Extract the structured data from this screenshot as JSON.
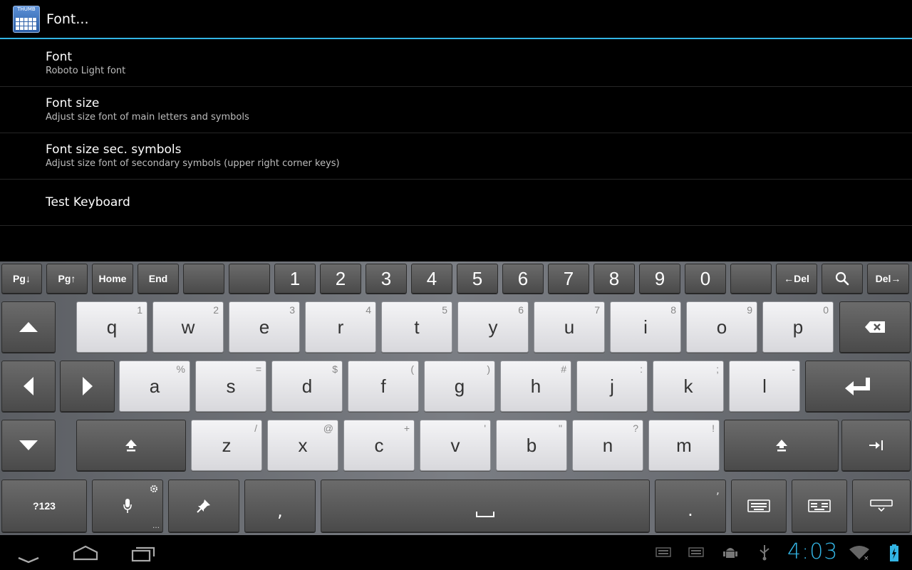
{
  "actionbar": {
    "icon_text": "THUMB",
    "title": "Font..."
  },
  "prefs": [
    {
      "title": "Font",
      "summary": "Roboto Light font"
    },
    {
      "title": "Font size",
      "summary": "Adjust size font of main letters and symbols"
    },
    {
      "title": "Font size sec. symbols",
      "summary": "Adjust size font of secondary symbols (upper right corner keys)"
    },
    {
      "title": "Test Keyboard",
      "summary": ""
    }
  ],
  "keyboard": {
    "toprow": {
      "pgdn": "Pg↓",
      "pgup": "Pg↑",
      "home": "Home",
      "end": "End",
      "n1": "1",
      "n2": "2",
      "n3": "3",
      "n4": "4",
      "n5": "5",
      "n6": "6",
      "n7": "7",
      "n8": "8",
      "n9": "9",
      "n0": "0",
      "del_left": "←Del",
      "del_right": "Del→"
    },
    "row1": [
      {
        "main": "q",
        "sec": "1"
      },
      {
        "main": "w",
        "sec": "2"
      },
      {
        "main": "e",
        "sec": "3"
      },
      {
        "main": "r",
        "sec": "4"
      },
      {
        "main": "t",
        "sec": "5"
      },
      {
        "main": "y",
        "sec": "6"
      },
      {
        "main": "u",
        "sec": "7"
      },
      {
        "main": "i",
        "sec": "8"
      },
      {
        "main": "o",
        "sec": "9"
      },
      {
        "main": "p",
        "sec": "0"
      }
    ],
    "row2": [
      {
        "main": "a",
        "sec": "%"
      },
      {
        "main": "s",
        "sec": "="
      },
      {
        "main": "d",
        "sec": "$"
      },
      {
        "main": "f",
        "sec": "("
      },
      {
        "main": "g",
        "sec": ")"
      },
      {
        "main": "h",
        "sec": "#"
      },
      {
        "main": "j",
        "sec": ":"
      },
      {
        "main": "k",
        "sec": ";"
      },
      {
        "main": "l",
        "sec": "-"
      }
    ],
    "row3": [
      {
        "main": "z",
        "sec": "/"
      },
      {
        "main": "x",
        "sec": "@"
      },
      {
        "main": "c",
        "sec": "+"
      },
      {
        "main": "v",
        "sec": "'"
      },
      {
        "main": "b",
        "sec": "\""
      },
      {
        "main": "n",
        "sec": "?"
      },
      {
        "main": "m",
        "sec": "!"
      }
    ],
    "bottom": {
      "sym": "?123",
      "comma": ",",
      "period": ".",
      "period_sec": ","
    }
  },
  "status": {
    "time": "4:03"
  },
  "colors": {
    "accent": "#33b5e5"
  }
}
